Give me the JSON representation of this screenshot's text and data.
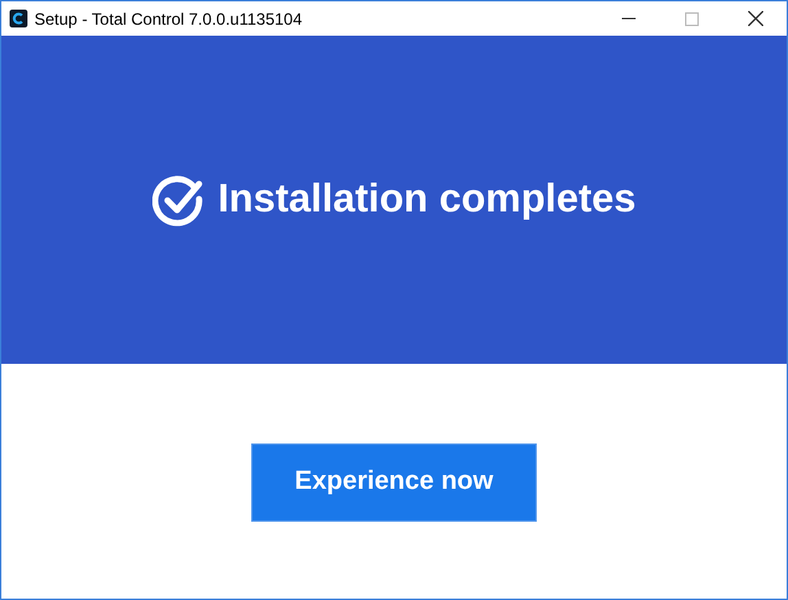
{
  "window": {
    "title": "Setup - Total Control 7.0.0.u1135104"
  },
  "banner": {
    "heading": "Installation completes"
  },
  "button": {
    "label": "Experience now"
  }
}
